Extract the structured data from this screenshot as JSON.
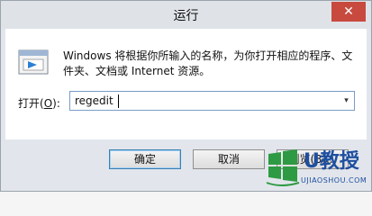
{
  "window": {
    "title": "运行",
    "close_symbol": "✕"
  },
  "dialog": {
    "description": "Windows 将根据你所输入的名称，为你打开相应的程序、文件夹、文档或 Internet 资源。",
    "open_label_prefix": "打开(",
    "open_label_key": "O",
    "open_label_suffix": "):",
    "command_value": "regedit",
    "dropdown_symbol": "▾"
  },
  "buttons": {
    "ok": "确定",
    "cancel": "取消",
    "browse": "浏览(B)..."
  },
  "watermark": {
    "brand": "U教授",
    "url": "UJIAOSHOU.COM"
  },
  "icons": {
    "app": "run-app-icon",
    "windows_logo": "windows-logo-icon"
  }
}
